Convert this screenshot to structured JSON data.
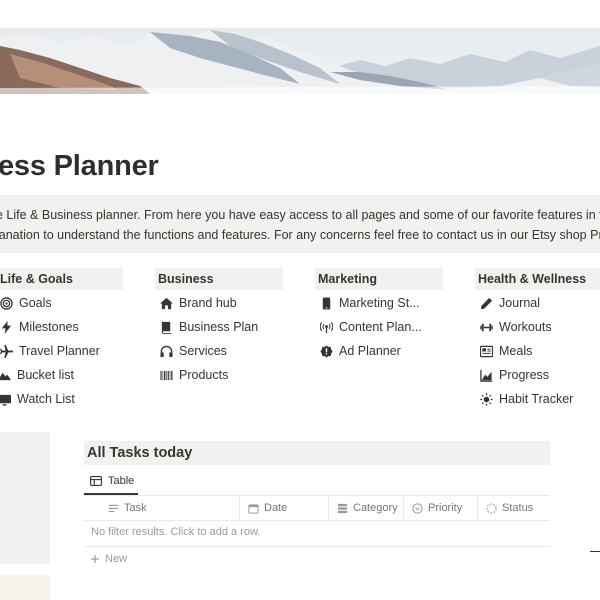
{
  "page": {
    "title": "ess Planner"
  },
  "intro": {
    "line1": "e Life & Business planner. From here you have easy access to all pages and some of our favorite features in the c",
    "line2": "lanation to understand the functions and features. For any concerns feel free to contact us in our Etsy shop Profi"
  },
  "columns": [
    {
      "heading": "Life & Goals",
      "items": [
        {
          "label": "Goals",
          "icon": "target-icon"
        },
        {
          "label": "Milestones",
          "icon": "lightning-icon"
        },
        {
          "label": "Travel Planner",
          "icon": "airplane-icon"
        },
        {
          "label": "Bucket list",
          "icon": "mountain-icon"
        },
        {
          "label": "Watch List",
          "icon": "monitor-icon"
        }
      ]
    },
    {
      "heading": "Business",
      "items": [
        {
          "label": "Brand hub",
          "icon": "house-icon"
        },
        {
          "label": "Business Plan",
          "icon": "book-icon"
        },
        {
          "label": "Services",
          "icon": "headphones-icon"
        },
        {
          "label": "Products",
          "icon": "barcode-icon"
        }
      ]
    },
    {
      "heading": "Marketing",
      "items": [
        {
          "label": "Marketing St...",
          "icon": "phone-icon"
        },
        {
          "label": "Content Plan...",
          "icon": "broadcast-icon"
        },
        {
          "label": "Ad Planner",
          "icon": "alert-badge-icon"
        }
      ]
    },
    {
      "heading": "Health & Wellness",
      "items": [
        {
          "label": "Journal",
          "icon": "pen-icon"
        },
        {
          "label": "Workouts",
          "icon": "dumbbell-icon"
        },
        {
          "label": "Meals",
          "icon": "newspaper-icon"
        },
        {
          "label": "Progress",
          "icon": "chart-icon"
        },
        {
          "label": "Habit Tracker",
          "icon": "sun-icon"
        }
      ]
    }
  ],
  "tasks": {
    "title": "All Tasks today",
    "view_tab": "Table",
    "columns": [
      {
        "label": "Task",
        "icon": "text-icon"
      },
      {
        "label": "Date",
        "icon": "calendar-icon"
      },
      {
        "label": "Category",
        "icon": "database-icon"
      },
      {
        "label": "Priority",
        "icon": "select-icon"
      },
      {
        "label": "Status",
        "icon": "status-icon"
      }
    ],
    "empty_message": "No filter results. Click to add a row.",
    "new_label": "New"
  },
  "colors": {
    "text": "#37352f",
    "muted": "#787774",
    "block_bg": "#f1f1ef"
  }
}
